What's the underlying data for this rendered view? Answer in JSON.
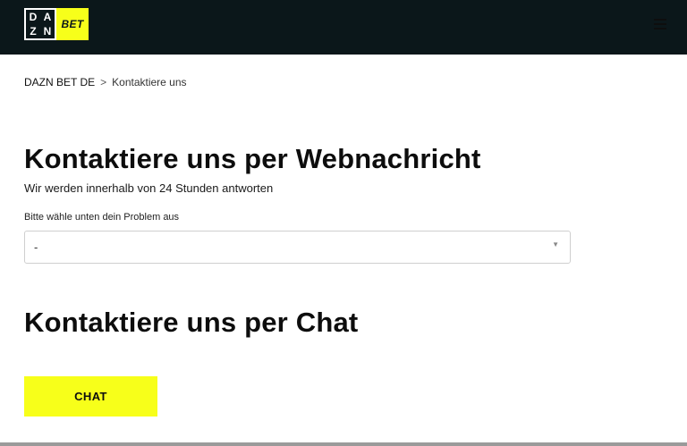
{
  "header": {
    "logo_letters": [
      "D",
      "A",
      "Z",
      "N"
    ],
    "logo_bet": "BET",
    "menu_icon": "hamburger-menu-icon",
    "colors": {
      "background": "#0b171a",
      "accent": "#f7ff1a"
    }
  },
  "breadcrumb": {
    "home": "DAZN BET DE",
    "separator": ">",
    "current": "Kontaktiere uns"
  },
  "web_message": {
    "title": "Kontaktiere uns per Webnachricht",
    "subtitle": "Wir werden innerhalb von 24 Stunden antworten",
    "select_label": "Bitte wähle unten dein Problem aus",
    "select_value": "-",
    "select_arrow": "▼"
  },
  "chat": {
    "title": "Kontaktiere uns per Chat",
    "button_label": "CHAT"
  }
}
